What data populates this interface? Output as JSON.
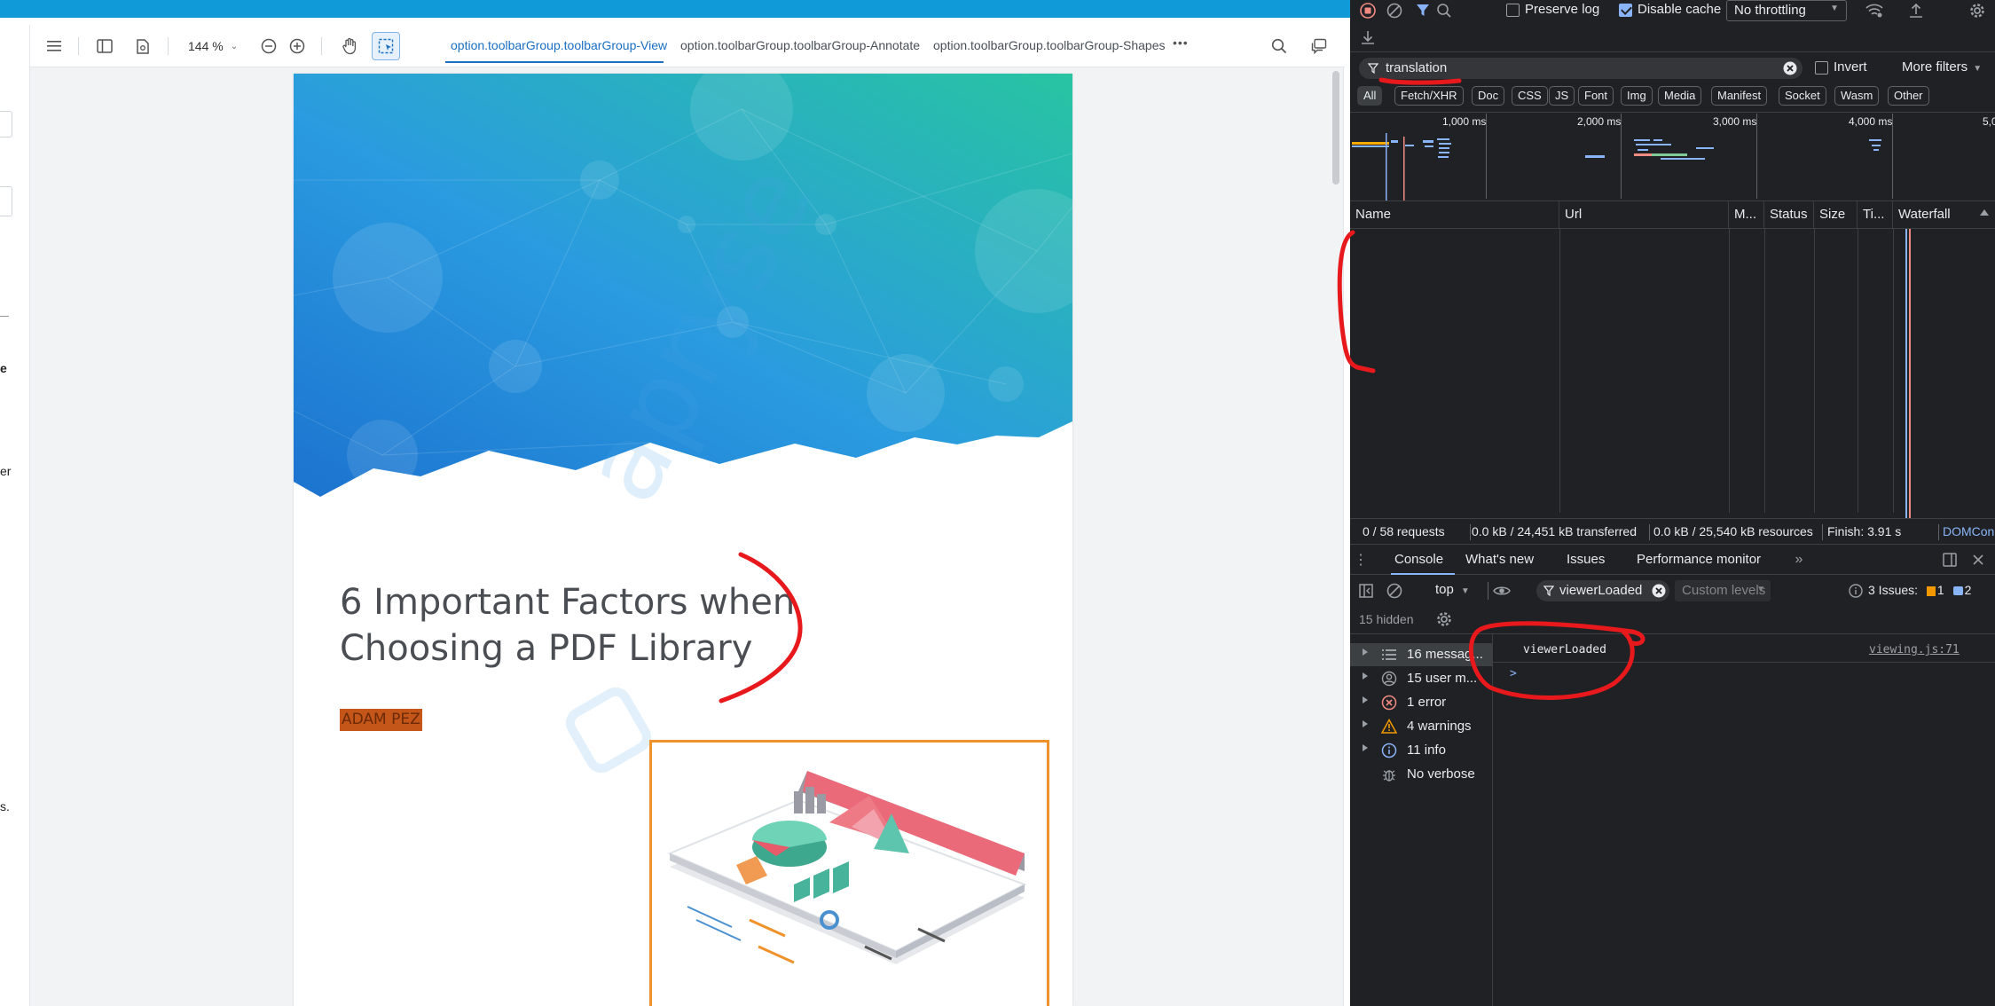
{
  "left_panel": {
    "side_texts": [
      "e",
      "er",
      "s."
    ]
  },
  "viewer": {
    "zoom": "144 %",
    "tabs": [
      "option.toolbarGroup.toolbarGroup-View",
      "option.toolbarGroup.toolbarGroup-Annotate",
      "option.toolbarGroup.toolbarGroup-Shapes"
    ],
    "more_label": "•••",
    "document": {
      "title_line1": "6 Important Factors when",
      "title_line2": "Choosing a PDF Library",
      "author": "ADAM PEZ",
      "watermark": "apryse"
    },
    "colors": {
      "accent": "#1a6fc3",
      "hero_start": "#1f86d6",
      "hero_end": "#27c0a6",
      "author_bg": "#c4561a",
      "frame": "#f0922b"
    }
  },
  "devtools": {
    "toolbar": {
      "preserve_log": "Preserve log",
      "disable_cache": "Disable cache",
      "throttling": "No throttling"
    },
    "filter": {
      "value": "translation",
      "invert": "Invert",
      "more_filters": "More filters"
    },
    "type_filters": [
      "All",
      "Fetch/XHR",
      "Doc",
      "CSS",
      "JS",
      "Font",
      "Img",
      "Media",
      "Manifest",
      "Socket",
      "Wasm",
      "Other"
    ],
    "overview_ticks": [
      "1,000 ms",
      "2,000 ms",
      "3,000 ms",
      "4,000 ms",
      "5,0"
    ],
    "columns": [
      "Name",
      "Url",
      "M...",
      "Status",
      "Size",
      "Ti...",
      "Waterfall"
    ],
    "status": {
      "requests": "0 / 58 requests",
      "transferred": "0.0 kB / 24,451 kB transferred",
      "resources": "0.0 kB / 25,540 kB resources",
      "finish": "Finish: 3.91 s",
      "domcontent": "DOMCon"
    },
    "drawer_tabs": [
      "Console",
      "What's new",
      "Issues",
      "Performance monitor"
    ],
    "console": {
      "context": "top",
      "filter_value": "viewerLoaded",
      "levels": "Custom levels",
      "issues_label": "3 Issues:",
      "issues_warn_count": "1",
      "issues_info_count": "2",
      "hidden": "15 hidden",
      "sidebar": [
        {
          "label": "16 messag...",
          "icon": "list-icon"
        },
        {
          "label": "15 user m...",
          "icon": "user-icon"
        },
        {
          "label": "1 error",
          "icon": "error-icon"
        },
        {
          "label": "4 warnings",
          "icon": "warning-icon"
        },
        {
          "label": "11 info",
          "icon": "info-icon"
        },
        {
          "label": "No verbose",
          "icon": "bug-icon"
        }
      ],
      "message": "viewerLoaded",
      "source": "viewing.js:71",
      "prompt": ">"
    }
  }
}
